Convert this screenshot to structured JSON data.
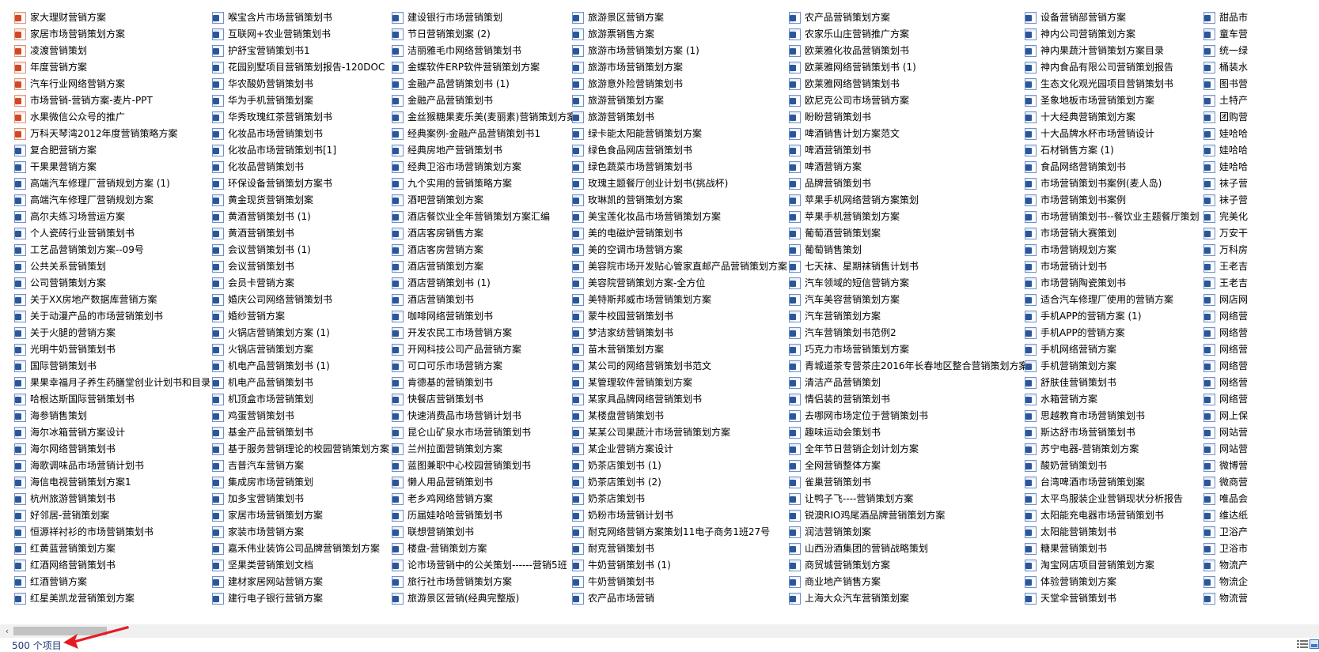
{
  "status": {
    "item_count": "500 个项目"
  },
  "scrollbar": {
    "left_arrow": "‹"
  },
  "columns": [
    {
      "items": [
        {
          "name": "家大理财营销方案",
          "type": "ppt"
        },
        {
          "name": "家居市场营销策划方案",
          "type": "ppt"
        },
        {
          "name": "凌渡营销策划",
          "type": "ppt"
        },
        {
          "name": "年度营销方案",
          "type": "ppt"
        },
        {
          "name": "汽车行业网络营销方案",
          "type": "ppt"
        },
        {
          "name": "市场营销-营销方案-麦片-PPT",
          "type": "ppt"
        },
        {
          "name": "水果微信公众号的推广",
          "type": "ppt"
        },
        {
          "name": "万科天琴湾2012年度营销策略方案",
          "type": "ppt"
        },
        {
          "name": "复合肥营销方案",
          "type": "word"
        },
        {
          "name": "干果果营销方案",
          "type": "word"
        },
        {
          "name": "高端汽车修理厂营销规划方案 (1)",
          "type": "word"
        },
        {
          "name": "高端汽车修理厂营销规划方案",
          "type": "word"
        },
        {
          "name": "高尔夫练习场营运方案",
          "type": "word"
        },
        {
          "name": "个人瓷砖行业营销策划书",
          "type": "word"
        },
        {
          "name": "工艺品营销策划方案--09号",
          "type": "word"
        },
        {
          "name": "公共关系营销策划",
          "type": "word"
        },
        {
          "name": "公司营销策划方案",
          "type": "word"
        },
        {
          "name": "关于XX房地产数据库营销方案",
          "type": "word"
        },
        {
          "name": "关于动漫产品的市场营销策划书",
          "type": "word"
        },
        {
          "name": "关于火腿的营销方案",
          "type": "word"
        },
        {
          "name": "光明牛奶营销策划书",
          "type": "word"
        },
        {
          "name": "国际营销策划书",
          "type": "word"
        },
        {
          "name": "果果幸福月子养生药膳堂创业计划书和目录",
          "type": "word"
        },
        {
          "name": "哈根达斯国际营销策划书",
          "type": "word"
        },
        {
          "name": "海参销售策划",
          "type": "word"
        },
        {
          "name": "海尔冰箱营销方案设计",
          "type": "word"
        },
        {
          "name": "海尔网络营销策划书",
          "type": "word"
        },
        {
          "name": "海歌调味品市场营销计划书",
          "type": "word"
        },
        {
          "name": "海信电视营销策划方案1",
          "type": "word"
        },
        {
          "name": "杭州旅游营销策划书",
          "type": "word"
        },
        {
          "name": "好邻居-营销策划案",
          "type": "word"
        },
        {
          "name": "恒源祥衬衫的市场营销策划书",
          "type": "word"
        },
        {
          "name": "红黄蓝营销策划方案",
          "type": "word"
        },
        {
          "name": "红酒网络营销策划书",
          "type": "word"
        },
        {
          "name": "红酒营销方案",
          "type": "word"
        },
        {
          "name": "红星美凯龙营销策划方案",
          "type": "word"
        }
      ]
    },
    {
      "items": [
        {
          "name": "喉宝含片市场营销策划书",
          "type": "word"
        },
        {
          "name": "互联网+农业营销策划书",
          "type": "word"
        },
        {
          "name": "护舒宝营销策划书1",
          "type": "word"
        },
        {
          "name": "花园别墅项目营销策划报告-120DOC",
          "type": "word"
        },
        {
          "name": "华农酸奶营销策划书",
          "type": "word"
        },
        {
          "name": "华为手机营销策划案",
          "type": "word"
        },
        {
          "name": "华秀玫瑰红茶营销策划书",
          "type": "word"
        },
        {
          "name": "化妆品市场营销策划书",
          "type": "word"
        },
        {
          "name": "化妆品市场营销策划书[1]",
          "type": "word"
        },
        {
          "name": "化妆品营销策划书",
          "type": "word"
        },
        {
          "name": "环保设备营销策划方案书",
          "type": "word"
        },
        {
          "name": "黄金现货营销策划案",
          "type": "word"
        },
        {
          "name": "黄酒营销策划书 (1)",
          "type": "word"
        },
        {
          "name": "黄酒营销策划书",
          "type": "word"
        },
        {
          "name": "会议营销策划书 (1)",
          "type": "word"
        },
        {
          "name": "会议营销策划书",
          "type": "word"
        },
        {
          "name": "会员卡营销方案",
          "type": "word"
        },
        {
          "name": "婚庆公司网络营销策划书",
          "type": "word"
        },
        {
          "name": "婚纱营销方案",
          "type": "word"
        },
        {
          "name": "火锅店营销策划方案 (1)",
          "type": "word"
        },
        {
          "name": "火锅店营销策划方案",
          "type": "word"
        },
        {
          "name": "机电产品营销策划书 (1)",
          "type": "word"
        },
        {
          "name": "机电产品营销策划书",
          "type": "word"
        },
        {
          "name": "机顶盒市场营销策划",
          "type": "word"
        },
        {
          "name": "鸡蛋营销策划书",
          "type": "word"
        },
        {
          "name": "基金产品营销策划书",
          "type": "word"
        },
        {
          "name": "基于服务营销理论的校园营销策划方案",
          "type": "word"
        },
        {
          "name": "吉普汽车营销方案",
          "type": "word"
        },
        {
          "name": "集成房市场营销策划",
          "type": "word"
        },
        {
          "name": "加多宝营销策划书",
          "type": "word"
        },
        {
          "name": "家居市场营销策划方案",
          "type": "word"
        },
        {
          "name": "家装市场营销方案",
          "type": "word"
        },
        {
          "name": "嘉禾伟业装饰公司品牌营销策划方案",
          "type": "word"
        },
        {
          "name": "坚果类营销策划文档",
          "type": "word"
        },
        {
          "name": "建材家居网站营销方案",
          "type": "word"
        },
        {
          "name": "建行电子银行营销方案",
          "type": "word"
        }
      ]
    },
    {
      "items": [
        {
          "name": "建设银行市场营销策划",
          "type": "word"
        },
        {
          "name": "节日营销策划案 (2)",
          "type": "word"
        },
        {
          "name": "洁丽雅毛巾网络营销策划书",
          "type": "word"
        },
        {
          "name": "金蝶软件ERP软件营销策划方案",
          "type": "word"
        },
        {
          "name": "金融产品营销策划书 (1)",
          "type": "word"
        },
        {
          "name": "金融产品营销策划书",
          "type": "word"
        },
        {
          "name": "金丝猴糖果麦乐美(麦丽素)营销策划方案",
          "type": "word"
        },
        {
          "name": "经典案例-金融产品营销策划书1",
          "type": "word"
        },
        {
          "name": "经典房地产营销策划书",
          "type": "word"
        },
        {
          "name": "经典卫浴市场营销策划方案",
          "type": "word"
        },
        {
          "name": "九个实用的营销策略方案",
          "type": "word"
        },
        {
          "name": "酒吧营销策划方案",
          "type": "word"
        },
        {
          "name": "酒店餐饮业全年营销策划方案汇编",
          "type": "word"
        },
        {
          "name": "酒店客房销售方案",
          "type": "word"
        },
        {
          "name": "酒店客房营销方案",
          "type": "word"
        },
        {
          "name": "酒店营销策划方案",
          "type": "word"
        },
        {
          "name": "酒店营销策划书 (1)",
          "type": "word"
        },
        {
          "name": "酒店营销策划书",
          "type": "word"
        },
        {
          "name": "咖啡网络营销策划书",
          "type": "word"
        },
        {
          "name": "开发农民工市场营销方案",
          "type": "word"
        },
        {
          "name": "开网科技公司产品营销方案",
          "type": "word"
        },
        {
          "name": "可口可乐市场营销方案",
          "type": "word"
        },
        {
          "name": "肯德基的营销策划书",
          "type": "word"
        },
        {
          "name": "快餐店营销策划书",
          "type": "word"
        },
        {
          "name": "快速消费品市场营销计划书",
          "type": "word"
        },
        {
          "name": "昆仑山矿泉水市场营销策划书",
          "type": "word"
        },
        {
          "name": "兰州拉面营销策划方案",
          "type": "word"
        },
        {
          "name": "蓝图兼职中心校园营销策划书",
          "type": "word"
        },
        {
          "name": "懒人用品营销策划书",
          "type": "word"
        },
        {
          "name": "老乡鸡网络营销方案",
          "type": "word"
        },
        {
          "name": "历届娃哈哈营销策划书",
          "type": "word"
        },
        {
          "name": "联想营销策划书",
          "type": "word"
        },
        {
          "name": "楼盘-营销策划方案",
          "type": "word"
        },
        {
          "name": "论市场营销中的公关策划------营销5班",
          "type": "word"
        },
        {
          "name": "旅行社市场营销策划方案",
          "type": "word"
        },
        {
          "name": "旅游景区营销(经典完整版)",
          "type": "word"
        }
      ]
    },
    {
      "items": [
        {
          "name": "旅游景区营销方案",
          "type": "word"
        },
        {
          "name": "旅游票销售方案",
          "type": "word"
        },
        {
          "name": "旅游市场营销策划方案 (1)",
          "type": "word"
        },
        {
          "name": "旅游市场营销策划方案",
          "type": "word"
        },
        {
          "name": "旅游意外险营销策划书",
          "type": "word"
        },
        {
          "name": "旅游营销策划方案",
          "type": "word"
        },
        {
          "name": "旅游营销策划书",
          "type": "word"
        },
        {
          "name": "绿卡能太阳能营销策划方案",
          "type": "word"
        },
        {
          "name": "绿色食品网店营销策划书",
          "type": "word"
        },
        {
          "name": "绿色蔬菜市场营销策划书",
          "type": "word"
        },
        {
          "name": "玫瑰主题餐厅创业计划书(挑战杯)",
          "type": "word"
        },
        {
          "name": "玫琳凯的营销策划方案",
          "type": "word"
        },
        {
          "name": "美宝莲化妆品市场营销策划方案",
          "type": "word"
        },
        {
          "name": "美的电磁炉营销策划书",
          "type": "word"
        },
        {
          "name": "美的空调市场营销方案",
          "type": "word"
        },
        {
          "name": "美容院市场开发贴心管家直邮产品营销策划方案",
          "type": "word"
        },
        {
          "name": "美容院营销策划方案-全方位",
          "type": "word"
        },
        {
          "name": "美特斯邦威市场营销策划方案",
          "type": "word"
        },
        {
          "name": "蒙牛校园营销策划书",
          "type": "word"
        },
        {
          "name": "梦洁家纺营销策划书",
          "type": "word"
        },
        {
          "name": "苗木营销策划方案",
          "type": "word"
        },
        {
          "name": "某公司的网络营销策划书范文",
          "type": "word"
        },
        {
          "name": "某管理软件营销策划方案",
          "type": "word"
        },
        {
          "name": "某家具品牌网络营销策划书",
          "type": "word"
        },
        {
          "name": "某楼盘营销策划书",
          "type": "word"
        },
        {
          "name": "某某公司果蔬汁市场营销策划方案",
          "type": "word"
        },
        {
          "name": "某企业营销方案设计",
          "type": "word"
        },
        {
          "name": "奶茶店策划书 (1)",
          "type": "word"
        },
        {
          "name": "奶茶店策划书 (2)",
          "type": "word"
        },
        {
          "name": "奶茶店策划书",
          "type": "word"
        },
        {
          "name": "奶粉市场营销计划书",
          "type": "word"
        },
        {
          "name": "耐克网络营销方案策划11电子商务1班27号",
          "type": "word"
        },
        {
          "name": "耐克营销策划书",
          "type": "word"
        },
        {
          "name": "牛奶营销策划书 (1)",
          "type": "word"
        },
        {
          "name": "牛奶营销策划书",
          "type": "word"
        },
        {
          "name": "农产品市场营销",
          "type": "word"
        }
      ]
    },
    {
      "items": [
        {
          "name": "农产品营销策划方案",
          "type": "word"
        },
        {
          "name": "农家乐山庄营销推广方案",
          "type": "word"
        },
        {
          "name": "欧莱雅化妆品营销策划书",
          "type": "word"
        },
        {
          "name": "欧莱雅网络营销策划书 (1)",
          "type": "word"
        },
        {
          "name": "欧莱雅网络营销策划书",
          "type": "word"
        },
        {
          "name": "欧尼克公司市场营销方案",
          "type": "word"
        },
        {
          "name": "盼盼营销策划书",
          "type": "word"
        },
        {
          "name": "啤酒销售计划方案范文",
          "type": "word"
        },
        {
          "name": "啤酒营销策划书",
          "type": "word"
        },
        {
          "name": "啤酒营销方案",
          "type": "word"
        },
        {
          "name": "品牌营销策划书",
          "type": "word"
        },
        {
          "name": "苹果手机网络营销方案策划",
          "type": "word"
        },
        {
          "name": "苹果手机营销策划方案",
          "type": "word"
        },
        {
          "name": "葡萄酒营销策划案",
          "type": "word"
        },
        {
          "name": "葡萄销售策划",
          "type": "word"
        },
        {
          "name": "七天袜、星期袜销售计划书",
          "type": "word"
        },
        {
          "name": "汽车领域的短信营销方案",
          "type": "word"
        },
        {
          "name": "汽车美容营销策划方案",
          "type": "word"
        },
        {
          "name": "汽车营销策划方案",
          "type": "word"
        },
        {
          "name": "汽车营销策划书范例2",
          "type": "word"
        },
        {
          "name": "巧克力市场营销策划方案",
          "type": "word"
        },
        {
          "name": "青城道茶专营茶庄2016年长春地区整合营销策划方案",
          "type": "word"
        },
        {
          "name": "清洁产品营销策划",
          "type": "word"
        },
        {
          "name": "情侣装的营销策划书",
          "type": "word"
        },
        {
          "name": "去哪网市场定位于营销策划书",
          "type": "word"
        },
        {
          "name": "趣味运动会策划书",
          "type": "word"
        },
        {
          "name": "全年节日营销企划计划方案",
          "type": "word"
        },
        {
          "name": "全网营销整体方案",
          "type": "word"
        },
        {
          "name": "雀巢营销策划书",
          "type": "word"
        },
        {
          "name": "让鸭子飞----营销策划方案",
          "type": "word"
        },
        {
          "name": "锐澳RIO鸡尾酒品牌营销策划方案",
          "type": "word"
        },
        {
          "name": "润洁营销策划案",
          "type": "word"
        },
        {
          "name": "山西汾酒集团的营销战略策划",
          "type": "word"
        },
        {
          "name": "商贸城营销策划方案",
          "type": "word"
        },
        {
          "name": "商业地产销售方案",
          "type": "word"
        },
        {
          "name": "上海大众汽车营销策划案",
          "type": "word"
        }
      ]
    },
    {
      "items": [
        {
          "name": "设备营销部营销方案",
          "type": "word"
        },
        {
          "name": "神内公司营销策划方案",
          "type": "word"
        },
        {
          "name": "神内果蔬汁营销策划方案目录",
          "type": "word"
        },
        {
          "name": "神内食品有限公司营销策划报告",
          "type": "word"
        },
        {
          "name": "生态文化观光园项目营销策划书",
          "type": "word"
        },
        {
          "name": "圣象地板市场营销策划方案",
          "type": "word"
        },
        {
          "name": "十大经典营销策划方案",
          "type": "word"
        },
        {
          "name": "十大品牌水杯市场营销设计",
          "type": "word"
        },
        {
          "name": "石材销售方案 (1)",
          "type": "word"
        },
        {
          "name": "食品网络营销策划书",
          "type": "word"
        },
        {
          "name": "市场营销策划书案例(麦人岛)",
          "type": "word"
        },
        {
          "name": "市场营销策划书案例",
          "type": "word"
        },
        {
          "name": "市场营销策划书--餐饮业主题餐厅策划",
          "type": "word"
        },
        {
          "name": "市场营销大赛策划",
          "type": "word"
        },
        {
          "name": "市场营销规划方案",
          "type": "word"
        },
        {
          "name": "市场营销计划书",
          "type": "word"
        },
        {
          "name": "市场营销陶瓷策划书",
          "type": "word"
        },
        {
          "name": "适合汽车修理厂使用的营销方案",
          "type": "word"
        },
        {
          "name": "手机APP的营销方案 (1)",
          "type": "word"
        },
        {
          "name": "手机APP的营销方案",
          "type": "word"
        },
        {
          "name": "手机网络营销方案",
          "type": "word"
        },
        {
          "name": "手机营销策划方案",
          "type": "word"
        },
        {
          "name": "舒肤佳营销策划书",
          "type": "word"
        },
        {
          "name": "水箱营销方案",
          "type": "word"
        },
        {
          "name": "思越教育市场营销策划书",
          "type": "word"
        },
        {
          "name": "斯达舒市场营销策划书",
          "type": "word"
        },
        {
          "name": "苏宁电器-营销策划方案",
          "type": "word"
        },
        {
          "name": "酸奶营销策划书",
          "type": "word"
        },
        {
          "name": "台湾啤酒市场营销策划案",
          "type": "word"
        },
        {
          "name": "太平鸟服装企业营销现状分析报告",
          "type": "word"
        },
        {
          "name": "太阳能充电器市场营销策划书",
          "type": "word"
        },
        {
          "name": "太阳能营销策划书",
          "type": "word"
        },
        {
          "name": "糖果营销策划书",
          "type": "word"
        },
        {
          "name": "淘宝网店项目营销策划方案",
          "type": "word"
        },
        {
          "name": "体验营销策划方案",
          "type": "word"
        },
        {
          "name": "天堂伞营销策划书",
          "type": "word"
        }
      ]
    },
    {
      "items": [
        {
          "name": "甜品市",
          "type": "word"
        },
        {
          "name": "童车营",
          "type": "word"
        },
        {
          "name": "统一绿",
          "type": "word"
        },
        {
          "name": "桶装水",
          "type": "word"
        },
        {
          "name": "图书营",
          "type": "word"
        },
        {
          "name": "土特产",
          "type": "word"
        },
        {
          "name": "团购营",
          "type": "word"
        },
        {
          "name": "娃哈哈",
          "type": "word"
        },
        {
          "name": "娃哈哈",
          "type": "word"
        },
        {
          "name": "娃哈哈",
          "type": "word"
        },
        {
          "name": "袜子营",
          "type": "word"
        },
        {
          "name": "袜子营",
          "type": "word"
        },
        {
          "name": "完美化",
          "type": "word"
        },
        {
          "name": "万安干",
          "type": "word"
        },
        {
          "name": "万科房",
          "type": "word"
        },
        {
          "name": "王老吉",
          "type": "word"
        },
        {
          "name": "王老吉",
          "type": "word"
        },
        {
          "name": "网店网",
          "type": "word"
        },
        {
          "name": "网络营",
          "type": "word"
        },
        {
          "name": "网络营",
          "type": "word"
        },
        {
          "name": "网络营",
          "type": "word"
        },
        {
          "name": "网络营",
          "type": "word"
        },
        {
          "name": "网络营",
          "type": "word"
        },
        {
          "name": "网络营",
          "type": "word"
        },
        {
          "name": "网上保",
          "type": "word"
        },
        {
          "name": "网站营",
          "type": "word"
        },
        {
          "name": "网站营",
          "type": "word"
        },
        {
          "name": "微博营",
          "type": "word"
        },
        {
          "name": "微商营",
          "type": "word"
        },
        {
          "name": "唯品会",
          "type": "word"
        },
        {
          "name": "维达纸",
          "type": "word"
        },
        {
          "name": "卫浴产",
          "type": "word"
        },
        {
          "name": "卫浴市",
          "type": "word"
        },
        {
          "name": "物流产",
          "type": "word"
        },
        {
          "name": "物流企",
          "type": "word"
        },
        {
          "name": "物流营",
          "type": "word"
        }
      ]
    }
  ]
}
